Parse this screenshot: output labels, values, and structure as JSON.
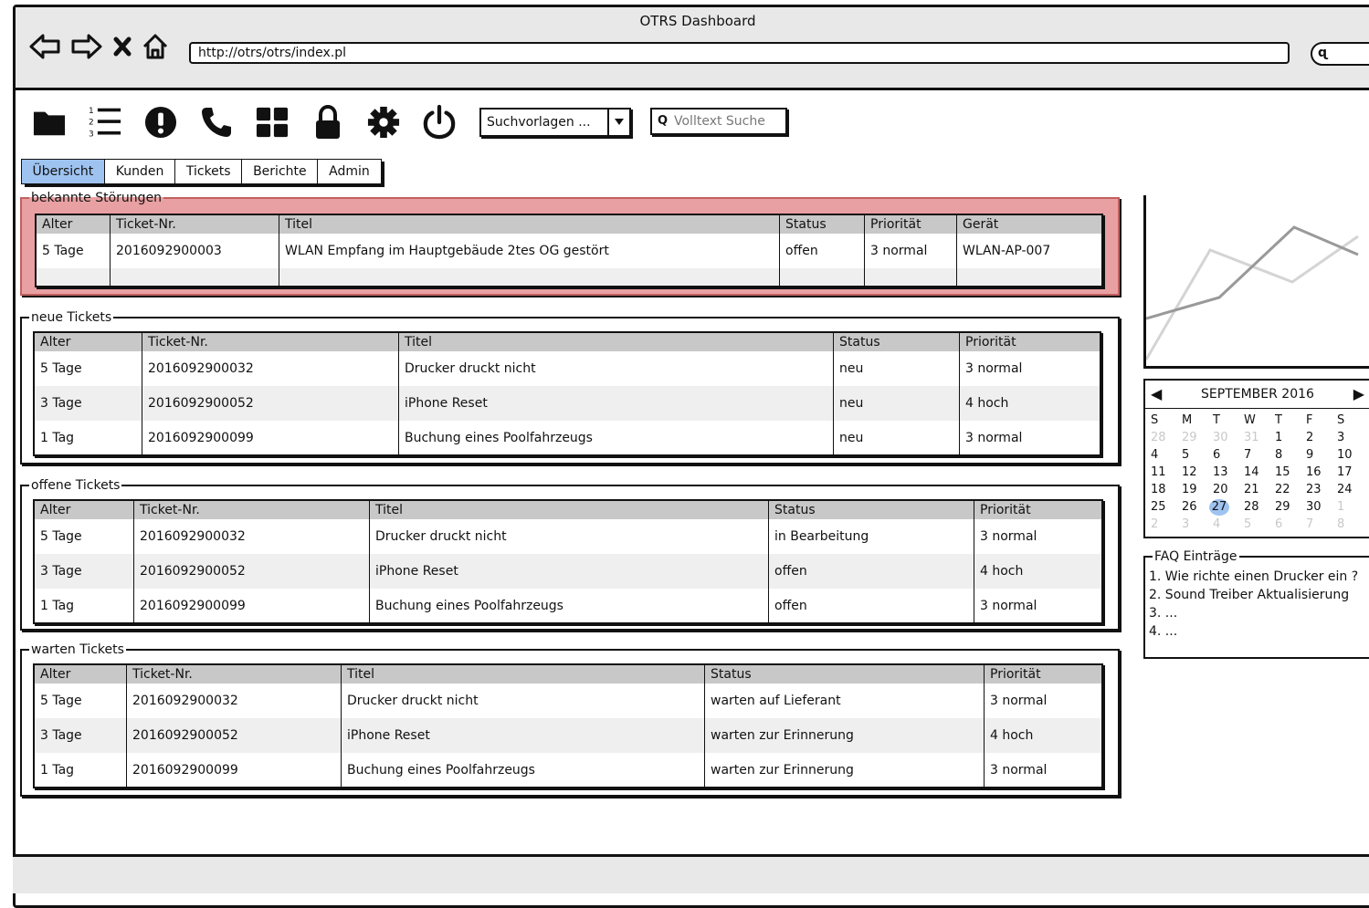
{
  "window": {
    "title": "OTRS Dashboard",
    "url": "http://otrs/otrs/index.pl"
  },
  "toolbar": {
    "icons": [
      "folder-icon",
      "numbered-list-icon",
      "alert-icon",
      "phone-icon",
      "dashboard-grid-icon",
      "lock-icon",
      "gear-icon",
      "power-icon"
    ],
    "search_templates": "Suchvorlagen ...",
    "fulltext_placeholder": "Volltext Suche"
  },
  "tabs": [
    {
      "label": "Übersicht",
      "active": true
    },
    {
      "label": "Kunden"
    },
    {
      "label": "Tickets"
    },
    {
      "label": "Berichte"
    },
    {
      "label": "Admin"
    }
  ],
  "known_issues": {
    "title": "bekannte Störungen",
    "headers": [
      "Alter",
      "Ticket-Nr.",
      "Titel",
      "Status",
      "Priorität",
      "Gerät"
    ],
    "rows": [
      [
        "5 Tage",
        "2016092900003",
        "WLAN Empfang im Hauptgebäude 2tes OG gestört",
        "offen",
        "3 normal",
        "WLAN-AP-007"
      ]
    ]
  },
  "new_tickets": {
    "title": "neue Tickets",
    "headers": [
      "Alter",
      "Ticket-Nr.",
      "Titel",
      "Status",
      "Priorität"
    ],
    "rows": [
      [
        "5 Tage",
        "2016092900032",
        "Drucker druckt nicht",
        "neu",
        "3 normal"
      ],
      [
        "3 Tage",
        "2016092900052",
        "iPhone Reset",
        "neu",
        "4 hoch"
      ],
      [
        "1 Tag",
        "2016092900099",
        "Buchung eines Poolfahrzeugs",
        "neu",
        "3 normal"
      ]
    ]
  },
  "open_tickets": {
    "title": "offene Tickets",
    "headers": [
      "Alter",
      "Ticket-Nr.",
      "Titel",
      "Status",
      "Priorität"
    ],
    "rows": [
      [
        "5 Tage",
        "2016092900032",
        "Drucker druckt nicht",
        "in Bearbeitung",
        "3 normal"
      ],
      [
        "3 Tage",
        "2016092900052",
        "iPhone Reset",
        "offen",
        "4 hoch"
      ],
      [
        "1 Tag",
        "2016092900099",
        "Buchung eines Poolfahrzeugs",
        "offen",
        "3 normal"
      ]
    ]
  },
  "waiting_tickets": {
    "title": "warten Tickets",
    "headers": [
      "Alter",
      "Ticket-Nr.",
      "Titel",
      "Status",
      "Priorität"
    ],
    "rows": [
      [
        "5 Tage",
        "2016092900032",
        "Drucker druckt nicht",
        "warten auf Lieferant",
        "3 normal"
      ],
      [
        "3 Tage",
        "2016092900052",
        "iPhone Reset",
        "warten zur Erinnerung",
        "4 hoch"
      ],
      [
        "1 Tag",
        "2016092900099",
        "Buchung eines Poolfahrzeugs",
        "warten zur Erinnerung",
        "3 normal"
      ]
    ]
  },
  "calendar": {
    "month": "SEPTEMBER 2016",
    "weekdays": [
      "S",
      "M",
      "T",
      "W",
      "T",
      "F",
      "S"
    ],
    "days": [
      [
        "28",
        "29",
        "30",
        "31",
        "1",
        "2",
        "3"
      ],
      [
        "4",
        "5",
        "6",
        "7",
        "8",
        "9",
        "10"
      ],
      [
        "11",
        "12",
        "13",
        "14",
        "15",
        "16",
        "17"
      ],
      [
        "18",
        "19",
        "20",
        "21",
        "22",
        "23",
        "24"
      ],
      [
        "25",
        "26",
        "27",
        "28",
        "29",
        "30",
        "1"
      ],
      [
        "2",
        "3",
        "4",
        "5",
        "6",
        "7",
        "8"
      ]
    ],
    "selected": "27"
  },
  "faq": {
    "title": "FAQ Einträge",
    "items": [
      "1. Wie richte einen Drucker ein ?",
      "2. Sound Treiber Aktualisierung",
      "3. ...",
      "4. ..."
    ]
  }
}
